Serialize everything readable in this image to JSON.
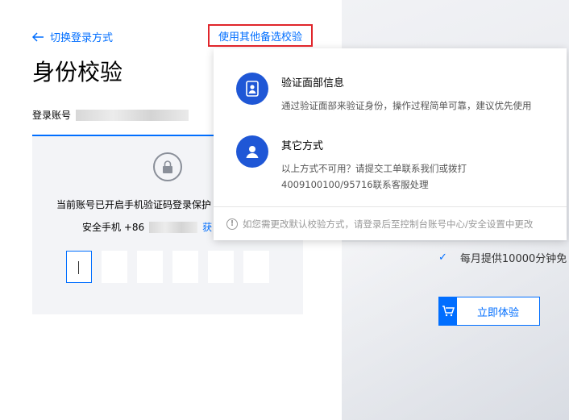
{
  "header": {
    "back_label": "切换登录方式",
    "alt_verify_label": "使用其他备选校验",
    "title": "身份校验"
  },
  "account": {
    "label": "登录账号"
  },
  "verify": {
    "notice": "当前账号已开启手机验证码登录保护",
    "phone_label": "安全手机 +86",
    "get_code_label": "获"
  },
  "popover": {
    "options": [
      {
        "title": "验证面部信息",
        "desc": "通过验证面部来验证身份，操作过程简单可靠，建议优先使用",
        "icon": "face-id-icon"
      },
      {
        "title": "其它方式",
        "desc_line1": "以上方式不可用？请提交工单联系我们或拨打",
        "desc_line2": "4009100100/95716联系客服处理",
        "icon": "user-icon"
      }
    ],
    "footer": "如您需更改默认校验方式，请登录后至控制台账号中心/安全设置中更改"
  },
  "promo": {
    "feature": "每月提供10000分钟免",
    "try_label": "立即体验"
  },
  "colors": {
    "accent": "#006eff",
    "highlight_border": "#e0252b",
    "icon_bg": "#1f57d6"
  }
}
